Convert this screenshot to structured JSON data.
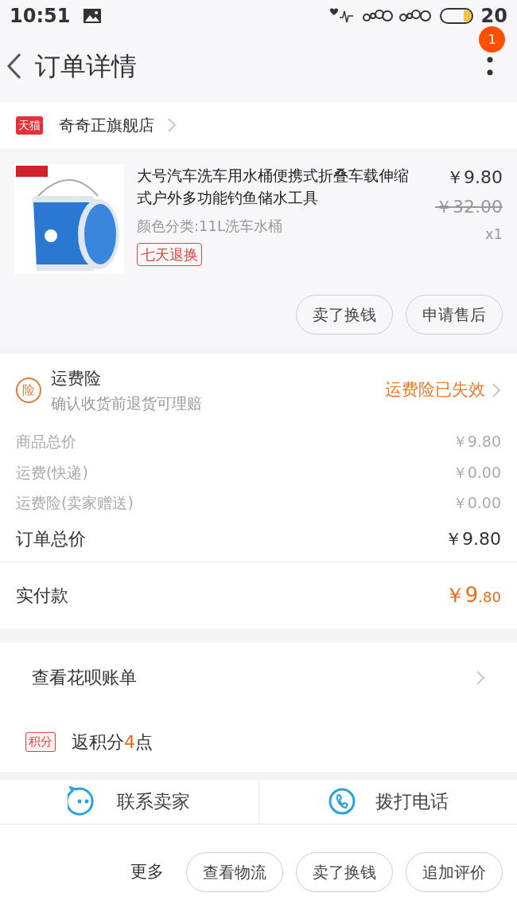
{
  "status_bar": {
    "time": "10:51",
    "battery": "20"
  },
  "header": {
    "title": "订单详情",
    "badge": "1"
  },
  "store": {
    "tag": "天猫",
    "name": "奇奇正旗舰店"
  },
  "product": {
    "title": "大号汽车洗车用水桶便携式折叠车载伸缩式户外多功能钓鱼储水工具",
    "sku": "颜色分类:11L洗车水桶",
    "tag": "七天退换",
    "price": "￥9.80",
    "original_price": "￥32.00",
    "quantity": "x1"
  },
  "product_buttons": [
    "卖了换钱",
    "申请售后"
  ],
  "insurance": {
    "icon_text": "险",
    "title": "运费险",
    "subtitle": "确认收货前退货可理赔",
    "status": "运费险已失效"
  },
  "price_rows": [
    {
      "label": "商品总价",
      "value": "￥9.80",
      "kind": "minor"
    },
    {
      "label": "运费(快递)",
      "value": "￥0.00",
      "kind": "minor"
    },
    {
      "label": "运费险(卖家赠送)",
      "value": "￥0.00",
      "kind": "minor"
    },
    {
      "label": "订单总价",
      "value": "￥9.80",
      "kind": "major"
    }
  ],
  "paid": {
    "label": "实付款",
    "main": "￥9",
    "fraction": ".80"
  },
  "huabei": {
    "label": "查看花呗账单"
  },
  "points": {
    "tag": "积分",
    "prefix": "返积分",
    "number": "4",
    "suffix": "点"
  },
  "contact": [
    "联系卖家",
    "拨打电话"
  ],
  "bottom_bar": {
    "more": "更多",
    "buttons": [
      "查看物流",
      "卖了换钱",
      "追加评价"
    ]
  }
}
